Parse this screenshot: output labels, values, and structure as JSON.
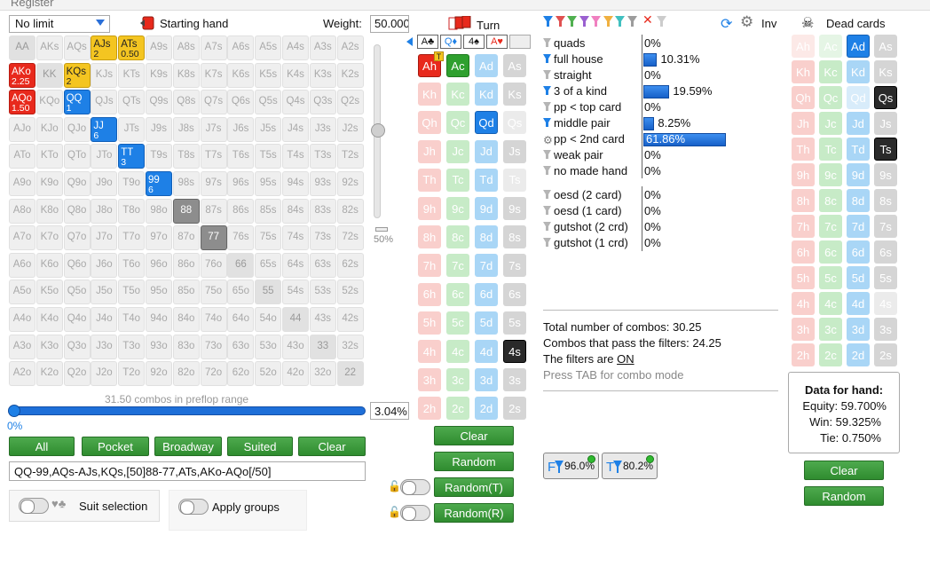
{
  "top": {
    "menu": "Register"
  },
  "left": {
    "limit_select": "No limit",
    "starting_hand_label": "Starting hand",
    "weight_label": "Weight:",
    "weight_value": "50.000",
    "vslider_pct": "50%",
    "combos_caption": "31.50 combos in preflop range",
    "slider_left": "0%",
    "slider_pct": "3.04%",
    "buttons": [
      "All",
      "Pocket",
      "Broadway",
      "Suited",
      "Clear"
    ],
    "range_text": "QQ-99,AQs-AJs,KQs,[50]88-77,ATs,AKo-AQo[/50]",
    "suit_selection": "Suit selection",
    "apply_groups": "Apply groups"
  },
  "grid": {
    "rows": [
      [
        "AA",
        "AKs",
        "AQs",
        "AJs",
        "ATs",
        "A9s",
        "A8s",
        "A7s",
        "A6s",
        "A5s",
        "A4s",
        "A3s",
        "A2s"
      ],
      [
        "AKo",
        "KK",
        "KQs",
        "KJs",
        "KTs",
        "K9s",
        "K8s",
        "K7s",
        "K6s",
        "K5s",
        "K4s",
        "K3s",
        "K2s"
      ],
      [
        "AQo",
        "KQo",
        "QQ",
        "QJs",
        "QTs",
        "Q9s",
        "Q8s",
        "Q7s",
        "Q6s",
        "Q5s",
        "Q4s",
        "Q3s",
        "Q2s"
      ],
      [
        "AJo",
        "KJo",
        "QJo",
        "JJ",
        "JTs",
        "J9s",
        "J8s",
        "J7s",
        "J6s",
        "J5s",
        "J4s",
        "J3s",
        "J2s"
      ],
      [
        "ATo",
        "KTo",
        "QTo",
        "JTo",
        "TT",
        "T9s",
        "T8s",
        "T7s",
        "T6s",
        "T5s",
        "T4s",
        "T3s",
        "T2s"
      ],
      [
        "A9o",
        "K9o",
        "Q9o",
        "J9o",
        "T9o",
        "99",
        "98s",
        "97s",
        "96s",
        "95s",
        "94s",
        "93s",
        "92s"
      ],
      [
        "A8o",
        "K8o",
        "Q8o",
        "J8o",
        "T8o",
        "98o",
        "88",
        "87s",
        "86s",
        "85s",
        "84s",
        "83s",
        "82s"
      ],
      [
        "A7o",
        "K7o",
        "Q7o",
        "J7o",
        "T7o",
        "97o",
        "87o",
        "77",
        "76s",
        "75s",
        "74s",
        "73s",
        "72s"
      ],
      [
        "A6o",
        "K6o",
        "Q6o",
        "J6o",
        "T6o",
        "96o",
        "86o",
        "76o",
        "66",
        "65s",
        "64s",
        "63s",
        "62s"
      ],
      [
        "A5o",
        "K5o",
        "Q5o",
        "J5o",
        "T5o",
        "95o",
        "85o",
        "75o",
        "65o",
        "55",
        "54s",
        "53s",
        "52s"
      ],
      [
        "A4o",
        "K4o",
        "Q4o",
        "J4o",
        "T4o",
        "94o",
        "84o",
        "74o",
        "64o",
        "54o",
        "44",
        "43s",
        "42s"
      ],
      [
        "A3o",
        "K3o",
        "Q3o",
        "J3o",
        "T3o",
        "93o",
        "83o",
        "73o",
        "63o",
        "53o",
        "43o",
        "33",
        "32s"
      ],
      [
        "A2o",
        "K2o",
        "Q2o",
        "J2o",
        "T2o",
        "92o",
        "82o",
        "72o",
        "62o",
        "52o",
        "42o",
        "32o",
        "22"
      ]
    ],
    "highlights": {
      "0,3": {
        "style": "yellow",
        "sub": "2"
      },
      "0,4": {
        "style": "yellow",
        "sub": "0.50"
      },
      "1,0": {
        "style": "red",
        "sub": "2.25"
      },
      "1,2": {
        "style": "yellow",
        "sub": "2"
      },
      "2,0": {
        "style": "red",
        "sub": "1.50"
      },
      "2,2": {
        "style": "blue",
        "sub": "1"
      },
      "3,3": {
        "style": "blue",
        "sub": "6"
      },
      "4,4": {
        "style": "blue",
        "sub": "3"
      },
      "5,5": {
        "style": "blue",
        "sub": "6"
      },
      "6,6": {
        "style": "grayhi",
        "sub": ""
      },
      "7,7": {
        "style": "grayhi",
        "sub": ""
      }
    }
  },
  "turn": {
    "title": "Turn",
    "board": [
      "A♣",
      "Q♦",
      "4♠",
      "A♥"
    ],
    "first_row": [
      {
        "t": "Ah",
        "k": "hS"
      },
      {
        "t": "Ac",
        "k": "cS"
      },
      {
        "t": "Ad",
        "k": "d"
      },
      {
        "t": "As",
        "k": "s"
      }
    ],
    "first_badge": "T",
    "ranks": [
      "K",
      "Q",
      "J",
      "T",
      "9",
      "8",
      "7",
      "6",
      "5",
      "4",
      "3",
      "2"
    ],
    "selected": {
      "Qd": "dS",
      "4s": "sS"
    },
    "faded": [
      "Qs",
      "Ts"
    ],
    "buttons": [
      "Clear",
      "Random",
      "Random(T)",
      "Random(R)"
    ]
  },
  "stats": {
    "inv": "Inv",
    "rows": [
      {
        "label": "quads",
        "value": "0%",
        "bar": 0
      },
      {
        "label": "full house",
        "value": "10.31%",
        "bar": 10.31
      },
      {
        "label": "straight",
        "value": "0%",
        "bar": 0
      },
      {
        "label": "3 of a kind",
        "value": "19.59%",
        "bar": 19.59
      },
      {
        "label": "pp < top card",
        "value": "0%",
        "bar": 0
      },
      {
        "label": "middle pair",
        "value": "8.25%",
        "bar": 8.25
      },
      {
        "label": "pp < 2nd card",
        "value": "61.86%",
        "bar": 61.86
      },
      {
        "label": "weak pair",
        "value": "0%",
        "bar": 0
      },
      {
        "label": "no made hand",
        "value": "0%",
        "bar": 0
      }
    ],
    "draws": [
      {
        "label": "oesd (2 card)",
        "value": "0%"
      },
      {
        "label": "oesd (1 card)",
        "value": "0%"
      },
      {
        "label": "gutshot (2 crd)",
        "value": "0%"
      },
      {
        "label": "gutshot (1 crd)",
        "value": "0%"
      }
    ],
    "total": "Total number of combos: 30.25",
    "pass": "Combos that pass the filters: 24.25",
    "filters_prefix": "The filters are ",
    "filters_state": "ON",
    "tab_hint": "Press TAB for combo mode",
    "f_btn": "96.0%",
    "t_btn": "80.2%",
    "colors": {
      "accent": "#1e80e6",
      "green": "#2f8c2f"
    }
  },
  "dead": {
    "title": "Dead cards",
    "ranks": [
      "A",
      "K",
      "Q",
      "J",
      "T",
      "9",
      "8",
      "7",
      "6",
      "5",
      "4",
      "3",
      "2"
    ],
    "selected": {
      "Ad": "dS",
      "Qs": "sS",
      "Ts": "sS"
    },
    "faded": [
      "Ah",
      "Ac",
      "Qd",
      "4s"
    ],
    "data_title": "Data for hand:",
    "equity": "Equity: 59.700%",
    "win": "Win: 59.325%",
    "tie": "Tie: 0.750%",
    "buttons": [
      "Clear",
      "Random"
    ]
  }
}
